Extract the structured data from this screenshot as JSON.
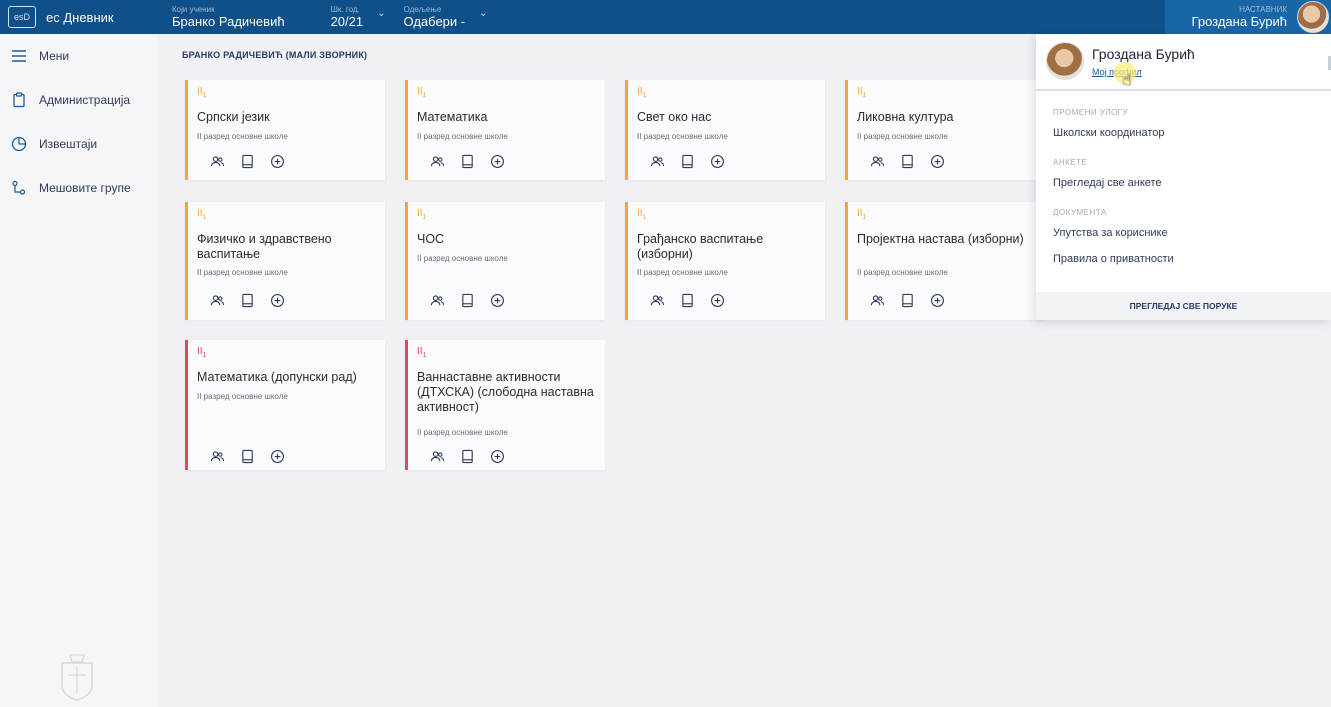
{
  "app": {
    "name": "ес Дневник",
    "logo_text": "esD"
  },
  "topbar": {
    "student": {
      "label": "Који ученик",
      "value": "Бранко Радичевић"
    },
    "year": {
      "label": "Шк. год.",
      "value": "20/21"
    },
    "class": {
      "label": "Одељење",
      "value": "Одабери -"
    },
    "user": {
      "label": "НАСТАВНИК",
      "value": "Гроздана Бурић"
    }
  },
  "sidebar": {
    "items": [
      {
        "label": "Мени",
        "icon": "menu-icon"
      },
      {
        "label": "Администрација",
        "icon": "clipboard-icon"
      },
      {
        "label": "Извештаји",
        "icon": "pie-chart-icon"
      },
      {
        "label": "Мешовите групе",
        "icon": "group-link-icon"
      }
    ]
  },
  "main": {
    "section_title": "БРАНКО РАДИЧЕВИЋ (МАЛИ ЗВОРНИК)",
    "cards": [
      {
        "badge": "II",
        "badge_sub": "1",
        "title": "Српски језик",
        "subtitle": "II разред основне школе",
        "color": "#f2a636"
      },
      {
        "badge": "II",
        "badge_sub": "1",
        "title": "Математика",
        "subtitle": "II разред основне школе",
        "color": "#f2a636"
      },
      {
        "badge": "II",
        "badge_sub": "1",
        "title": "Свет око нас",
        "subtitle": "II разред основне школе",
        "color": "#f2a636"
      },
      {
        "badge": "II",
        "badge_sub": "1",
        "title": "Ликовна култура",
        "subtitle": "II разред основне школе",
        "color": "#f2a636"
      },
      {
        "badge": "II",
        "badge_sub": "1",
        "title": "Физичко и здравствено васпитање",
        "subtitle": "II разред основне школе",
        "color": "#f2a636"
      },
      {
        "badge": "II",
        "badge_sub": "1",
        "title": "ЧОС",
        "subtitle": "II разред основне школе",
        "color": "#f2a636"
      },
      {
        "badge": "II",
        "badge_sub": "1",
        "title": "Грађанско васпитање (изборни)",
        "subtitle": "II разред основне школе",
        "color": "#f2a636"
      },
      {
        "badge": "II",
        "badge_sub": "1",
        "title": "Пројектна настава (изборни)",
        "subtitle": "II разред основне школе",
        "color": "#f2a636"
      },
      {
        "badge": "II",
        "badge_sub": "1",
        "title": "Математика (допунски рад)",
        "subtitle": "II разред основне школе",
        "color": "#e04a5f"
      },
      {
        "badge": "II",
        "badge_sub": "1",
        "title": "Ваннаставне активности (ДТХСКА) (слободна наставна активност)",
        "subtitle": "II разред основне школе",
        "color": "#e04a5f"
      }
    ],
    "card_actions": [
      "students-icon",
      "book-icon",
      "add-circle-icon"
    ]
  },
  "dropdown": {
    "name": "Гроздана Бурић",
    "profile_link": "Мој профил",
    "sections": [
      {
        "title": "ПРОМЕНИ УЛОГУ",
        "items": [
          "Школски координатор"
        ]
      },
      {
        "title": "АНКЕТЕ",
        "items": [
          "Прегледај све анкете"
        ]
      },
      {
        "title": "ДОКУМЕНТА",
        "items": [
          "Упутства за кориснике",
          "Правила о приватности"
        ]
      }
    ],
    "footer": "ПРЕГЛЕДАЈ СВЕ ПОРУКЕ"
  }
}
